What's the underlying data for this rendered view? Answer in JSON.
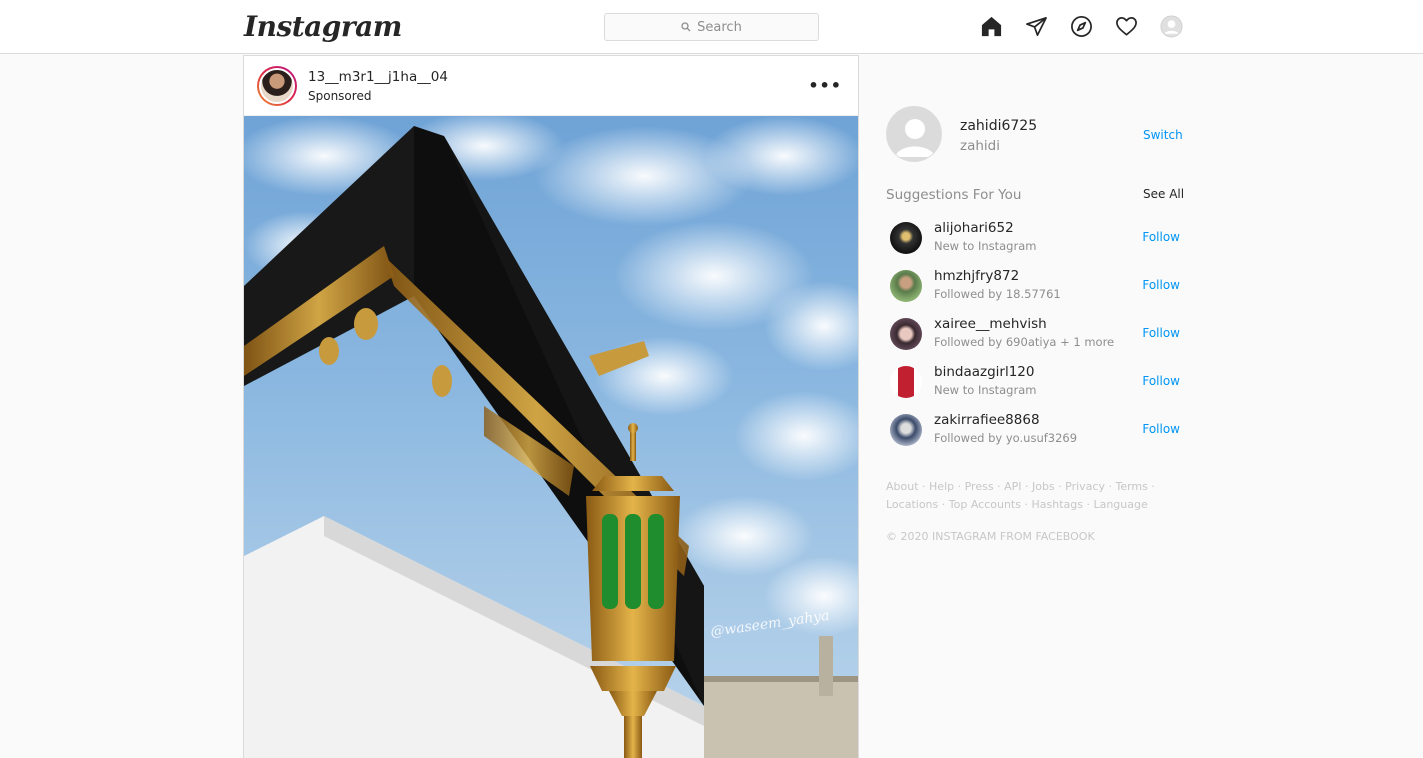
{
  "nav": {
    "logo": "Instagram",
    "search_placeholder": "Search",
    "icons": [
      "home-icon",
      "direct-icon",
      "explore-icon",
      "activity-icon",
      "profile-icon"
    ]
  },
  "post": {
    "username": "13__m3r1__j1ha__04",
    "subtitle": "Sponsored",
    "more_label": "•••",
    "watermark": "@waseem_yahya"
  },
  "sidebar": {
    "username": "zahidi6725",
    "fullname": "zahidi",
    "switch_label": "Switch",
    "suggestions_title": "Suggestions For You",
    "see_all_label": "See All",
    "suggestions": [
      {
        "username": "alijohari652",
        "subtitle": "New to Instagram",
        "action": "Follow"
      },
      {
        "username": "hmzhjfry872",
        "subtitle": "Followed by 18.57761",
        "action": "Follow"
      },
      {
        "username": "xairee__mehvish",
        "subtitle": "Followed by 690atiya + 1 more",
        "action": "Follow"
      },
      {
        "username": "bindaazgirl120",
        "subtitle": "New to Instagram",
        "action": "Follow"
      },
      {
        "username": "zakirrafiee8868",
        "subtitle": "Followed by yo.usuf3269",
        "action": "Follow"
      }
    ],
    "footer_row1": [
      "About",
      "Help",
      "Press",
      "API",
      "Jobs",
      "Privacy",
      "Terms"
    ],
    "footer_row2": [
      "Locations",
      "Top Accounts",
      "Hashtags",
      "Language"
    ],
    "copyright": "© 2020 INSTAGRAM FROM FACEBOOK"
  },
  "colors": {
    "accent": "#0095f6",
    "muted": "#8e8e8e",
    "border": "#dbdbdb"
  }
}
